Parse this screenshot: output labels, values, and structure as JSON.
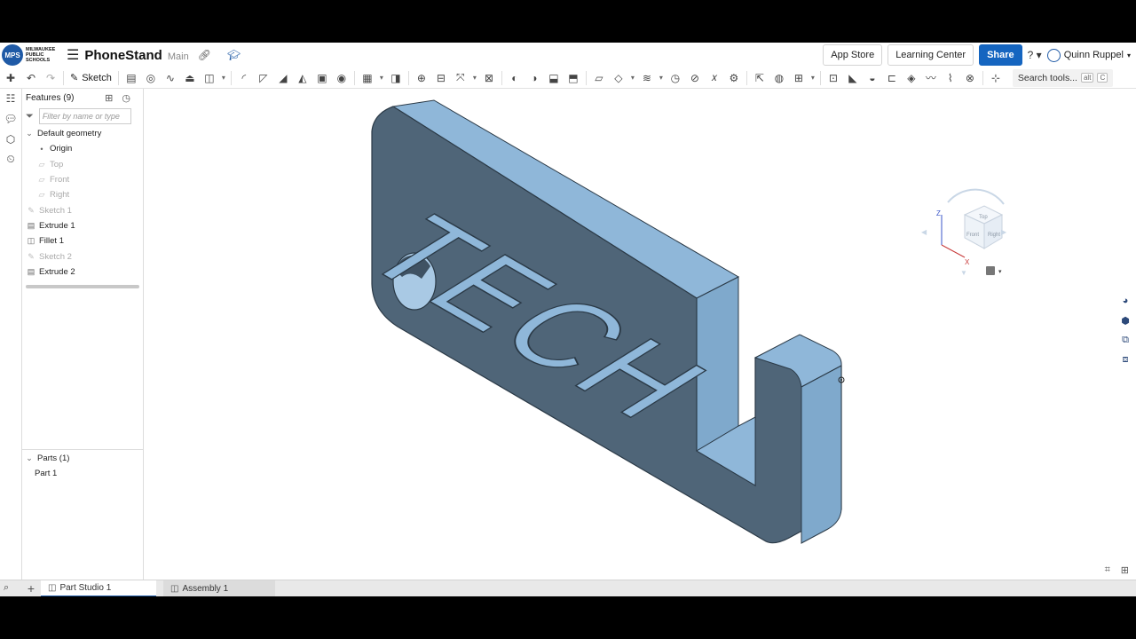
{
  "logo": {
    "initials": "MPS",
    "text": "MILWAUKEE PUBLIC SCHOOLS"
  },
  "document": {
    "name": "PhoneStand",
    "branch": "Main"
  },
  "topbar": {
    "app_store": "App Store",
    "learning_center": "Learning Center",
    "share": "Share",
    "help_icon": "?",
    "user_name": "Quinn Ruppel"
  },
  "toolbar": {
    "sketch_label": "Sketch",
    "search_label": "Search tools...",
    "search_shortcut_1": "alt",
    "search_shortcut_2": "C"
  },
  "features": {
    "header": "Features (9)",
    "filter_placeholder": "Filter by name or type",
    "group": "Default geometry",
    "items": [
      {
        "label": "Origin",
        "icon": "origin-dot-icon",
        "muted": false,
        "indent": 2
      },
      {
        "label": "Top",
        "icon": "plane-icon",
        "muted": true,
        "indent": 2
      },
      {
        "label": "Front",
        "icon": "plane-icon",
        "muted": true,
        "indent": 2
      },
      {
        "label": "Right",
        "icon": "plane-icon",
        "muted": true,
        "indent": 2
      },
      {
        "label": "Sketch 1",
        "icon": "sketch-icon",
        "muted": true,
        "indent": 1
      },
      {
        "label": "Extrude 1",
        "icon": "extrude-icon",
        "muted": false,
        "indent": 1
      },
      {
        "label": "Fillet 1",
        "icon": "fillet-icon",
        "muted": false,
        "indent": 1
      },
      {
        "label": "Sketch 2",
        "icon": "sketch-icon",
        "muted": true,
        "indent": 1
      },
      {
        "label": "Extrude 2",
        "icon": "extrude-icon",
        "muted": false,
        "indent": 1
      }
    ]
  },
  "parts": {
    "header": "Parts (1)",
    "items": [
      "Part 1"
    ]
  },
  "model": {
    "text": "TECH"
  },
  "view_cube": {
    "top": "Top",
    "front": "Front",
    "right": "Right",
    "axis_z": "Z",
    "axis_x": "X"
  },
  "tabs": [
    {
      "label": "Part Studio 1",
      "active": true
    },
    {
      "label": "Assembly 1",
      "active": false
    }
  ],
  "colors": {
    "accent": "#1565c0",
    "part_face": "#8cb4d8",
    "part_side": "#4c6378"
  }
}
